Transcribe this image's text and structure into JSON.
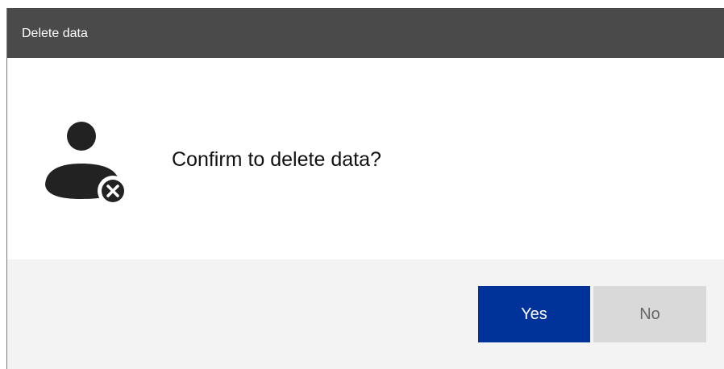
{
  "dialog": {
    "title": "Delete data",
    "message": "Confirm to delete data?",
    "icon": "user-delete-icon",
    "buttons": {
      "yes_label": "Yes",
      "no_label": "No"
    },
    "colors": {
      "titlebar": "#4a4a4a",
      "primary_button": "#003399",
      "secondary_button": "#d9d9d9",
      "footer": "#f3f3f3",
      "icon": "#222222"
    }
  }
}
